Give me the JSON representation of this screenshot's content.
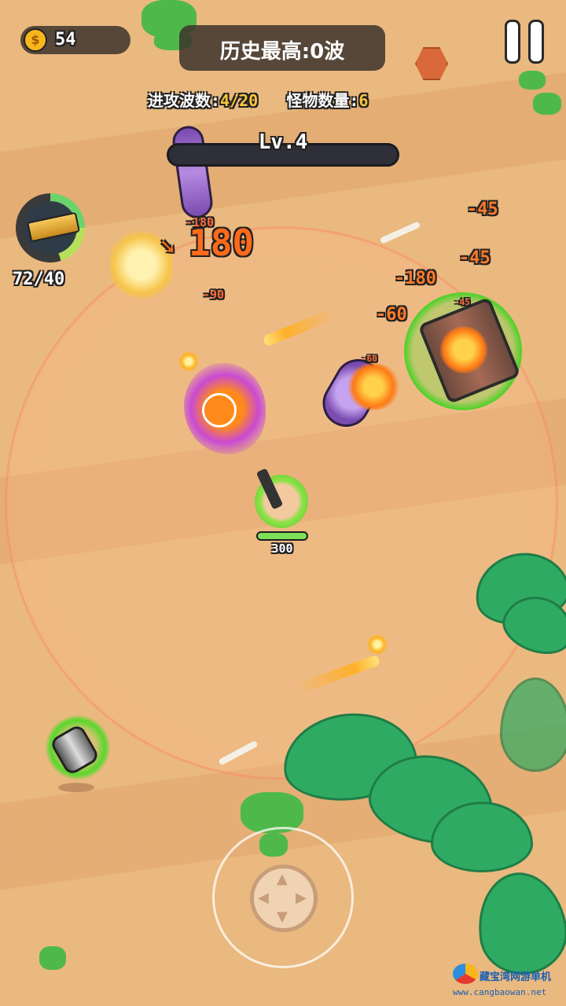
{
  "hud": {
    "coin_symbol": "$",
    "coins": "54",
    "best_record": "历史最高:0波",
    "wave_label": "进攻波数:",
    "wave_value": "4/20",
    "monster_label": "怪物数量:",
    "monster_value": "6",
    "level": "Lv.4",
    "ammo": "72/40"
  },
  "player": {
    "hp": "300"
  },
  "damage_numbers": [
    "-45",
    "-45",
    "-180",
    "-60",
    "180",
    "-90",
    "-180",
    "-45",
    "-60"
  ],
  "joystick": {
    "arrows": [
      "▲",
      "▼",
      "◀",
      "▶"
    ]
  },
  "watermark": {
    "name": "藏宝湾网游单机",
    "url": "www.cangbaowan.net"
  },
  "colors": {
    "accent_yellow": "#ffc53a",
    "damage_orange": "#ff7a2a",
    "sand": "#eab97f",
    "glow_green": "#4fd12a"
  }
}
